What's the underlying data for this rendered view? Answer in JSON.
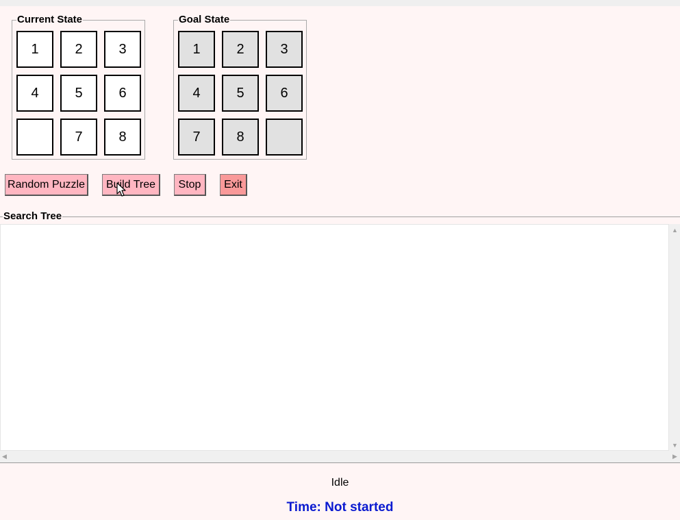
{
  "current_state": {
    "title": "Current State",
    "tiles": [
      "1",
      "2",
      "3",
      "4",
      "5",
      "6",
      "",
      "7",
      "8"
    ]
  },
  "goal_state": {
    "title": "Goal State",
    "tiles": [
      "1",
      "2",
      "3",
      "4",
      "5",
      "6",
      "7",
      "8",
      ""
    ]
  },
  "buttons": {
    "random": "Random Puzzle",
    "build": "Build Tree",
    "stop": "Stop",
    "exit": "Exit"
  },
  "search_tree": {
    "title": "Search Tree"
  },
  "status": "Idle",
  "time_label": "Time: Not started",
  "colors": {
    "background": "#fff5f5",
    "button": "#ffb6c1",
    "exit_button": "#f99999",
    "goal_tile": "#e1e1e1",
    "time_text": "#0a1ad0"
  }
}
